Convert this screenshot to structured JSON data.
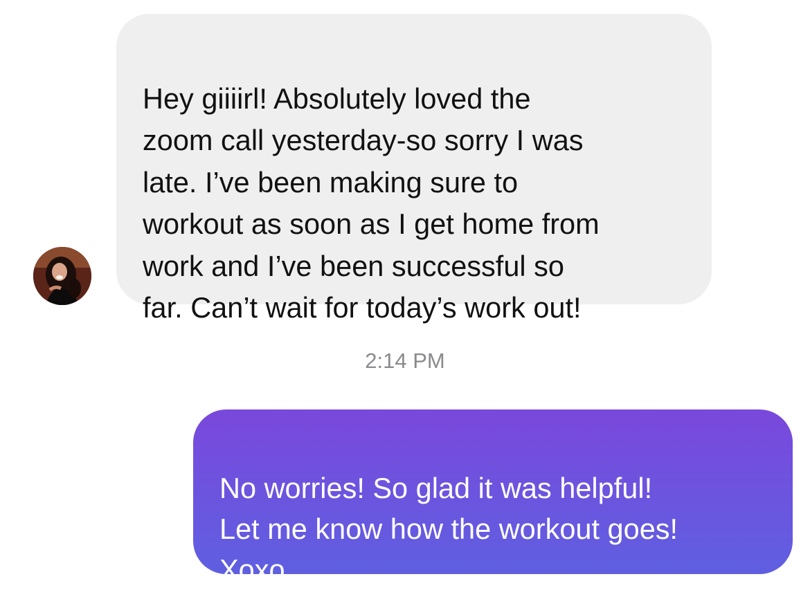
{
  "conversation": {
    "incoming_message": {
      "avatar_icon": "contact-avatar-photo",
      "text": "Hey giiiirl! Absolutely loved the\nzoom call yesterday-so sorry I was\nlate. I’ve been making sure to\nworkout as soon as I get home from\nwork and I’ve been successful so\nfar. Can’t wait for today’s work out!"
    },
    "timestamp": "2:14 PM",
    "outgoing_message": {
      "text": "No worries! So glad it was helpful!\nLet me know how the workout goes!\nXoxo"
    }
  },
  "colors": {
    "incoming_bubble": "#efefef",
    "outgoing_bubble_top": "#7a48dc",
    "outgoing_bubble_bottom": "#5f5fe0",
    "timestamp_text": "#8a8a8e"
  }
}
